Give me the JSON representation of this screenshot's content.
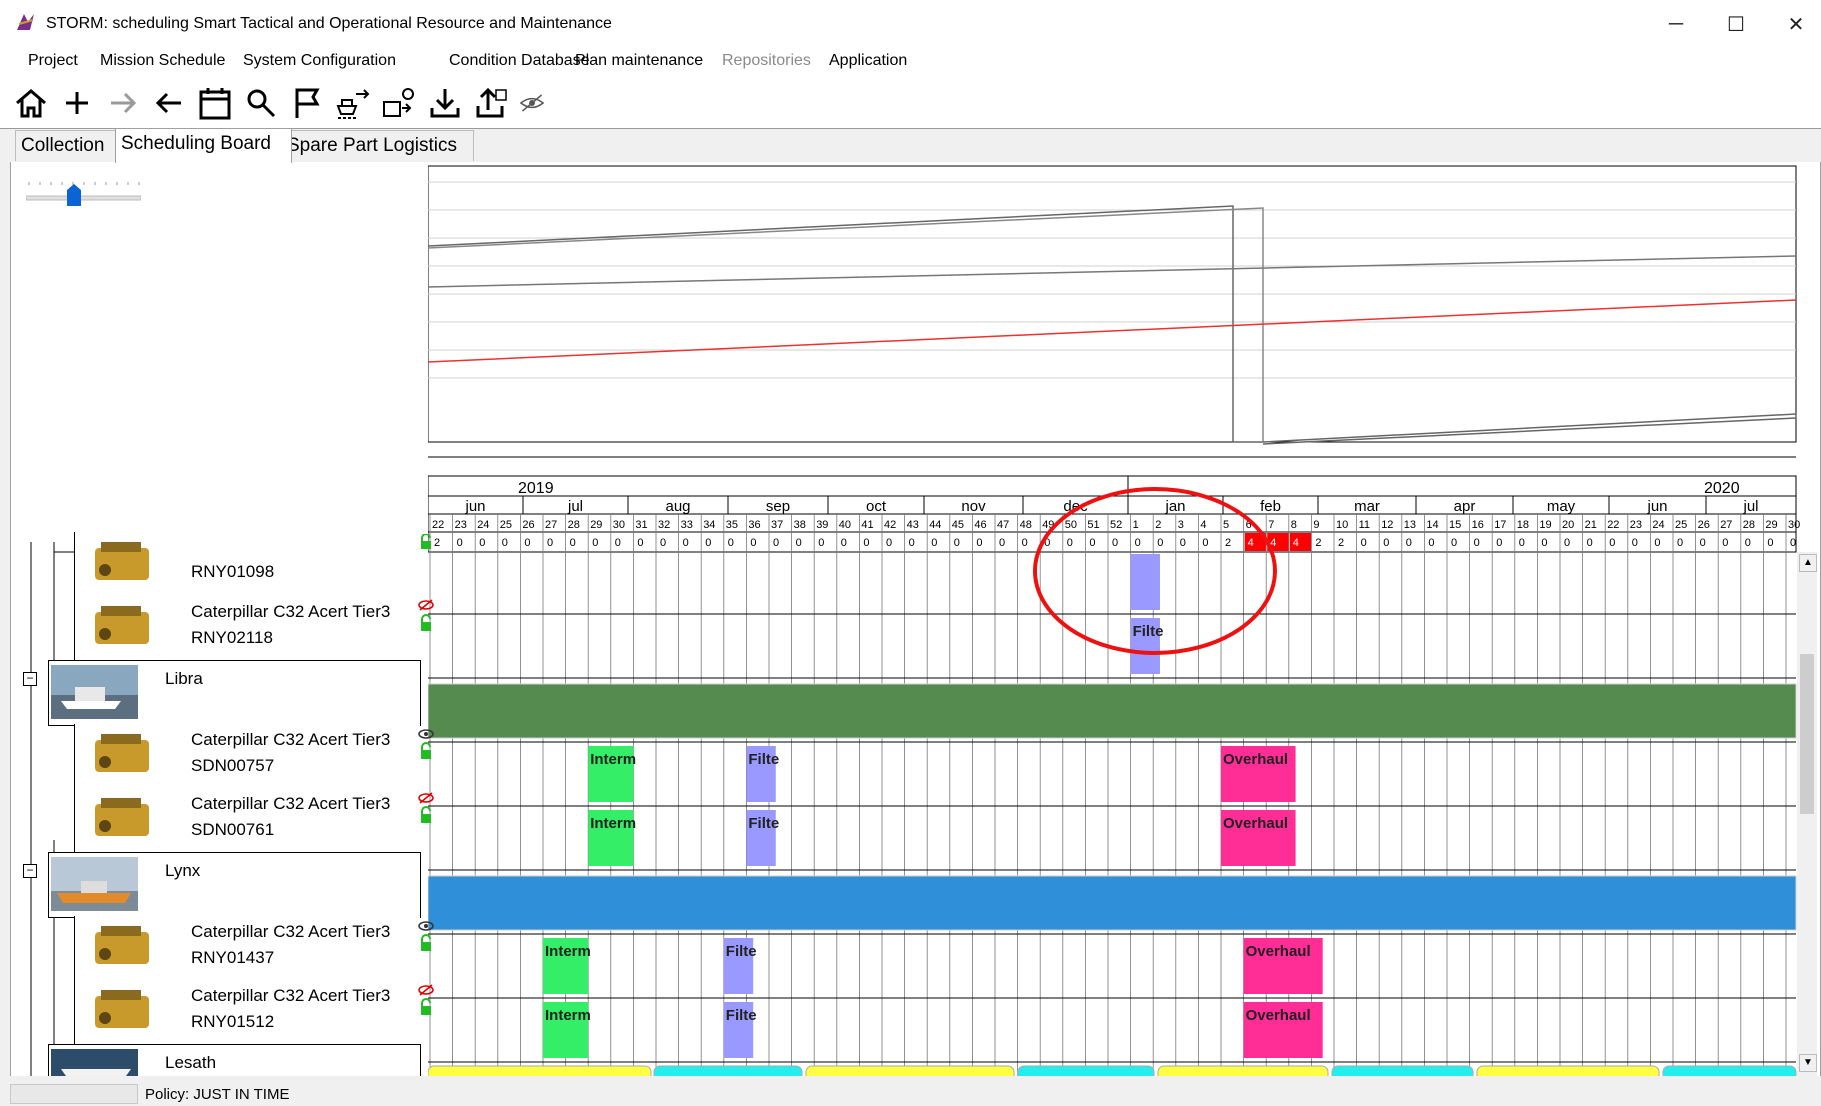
{
  "window": {
    "title": "STORM: scheduling Smart Tactical and Operational Resource and Maintenance",
    "minimize": "─",
    "maximize": "☐",
    "close": "✕"
  },
  "menu": [
    "Project",
    "Mission Schedule",
    "System Configuration",
    "Condition Database",
    "Plan maintenance",
    "Repositories",
    "Application"
  ],
  "toolbar": [
    "home-icon",
    "add-icon",
    "forward-arrow-icon",
    "back-arrow-icon",
    "calendar-icon",
    "search-icon",
    "flag-icon",
    "ship-transfer-icon",
    "engine-transfer-icon",
    "download-icon",
    "upload-icon",
    "visibility-icon"
  ],
  "tabs": [
    "Collection",
    "Scheduling Board",
    "Spare Part Logistics"
  ],
  "active_tab": "Scheduling Board",
  "timeline": {
    "years": [
      "2019",
      "2020"
    ],
    "months": [
      "jun",
      "jul",
      "aug",
      "sep",
      "oct",
      "nov",
      "dec",
      "jan",
      "feb",
      "mar",
      "apr",
      "may",
      "jun",
      "jul"
    ],
    "weeks": [
      "22",
      "23",
      "24",
      "25",
      "26",
      "27",
      "28",
      "29",
      "30",
      "31",
      "32",
      "33",
      "34",
      "35",
      "36",
      "37",
      "38",
      "39",
      "40",
      "41",
      "42",
      "43",
      "44",
      "45",
      "46",
      "47",
      "48",
      "49",
      "50",
      "51",
      "52",
      "1",
      "2",
      "3",
      "4",
      "5",
      "6",
      "7",
      "8",
      "9",
      "10",
      "11",
      "12",
      "13",
      "14",
      "15",
      "16",
      "17",
      "18",
      "19",
      "20",
      "21",
      "22",
      "23",
      "24",
      "25",
      "26",
      "27",
      "28",
      "29",
      "30"
    ],
    "counts": [
      "2",
      "0",
      "0",
      "0",
      "0",
      "0",
      "0",
      "0",
      "0",
      "0",
      "0",
      "0",
      "0",
      "0",
      "0",
      "0",
      "0",
      "0",
      "0",
      "0",
      "0",
      "0",
      "0",
      "0",
      "0",
      "0",
      "0",
      "0",
      "0",
      "0",
      "0",
      "0",
      "0",
      "0",
      "0",
      "2",
      "4",
      "4",
      "4",
      "2",
      "2",
      "0",
      "0",
      "0",
      "0",
      "0",
      "0",
      "0",
      "0",
      "0",
      "0",
      "0",
      "0",
      "0",
      "0",
      "0",
      "0",
      "0",
      "0",
      "0",
      "0"
    ],
    "highlight_color": "#ff0000",
    "annotation": "red-circle-highlight"
  },
  "rows": [
    {
      "kind": "resource",
      "line1": "",
      "line2": "RNY01098"
    },
    {
      "kind": "resource",
      "line1": "Caterpillar C32 Acert Tier3",
      "line2": "RNY02118"
    },
    {
      "kind": "ship",
      "name": "Libra",
      "color": "#558b4f"
    },
    {
      "kind": "resource",
      "line1": "Caterpillar C32 Acert Tier3",
      "line2": "SDN00757"
    },
    {
      "kind": "resource",
      "line1": "Caterpillar C32 Acert Tier3",
      "line2": "SDN00761"
    },
    {
      "kind": "ship",
      "name": "Lynx",
      "color": "#2f8fd8"
    },
    {
      "kind": "resource",
      "line1": "Caterpillar C32 Acert Tier3",
      "line2": "RNY01437"
    },
    {
      "kind": "resource",
      "line1": "Caterpillar C32 Acert Tier3",
      "line2": "RNY01512"
    },
    {
      "kind": "ship",
      "name": "Lesath",
      "color": "#ffff44"
    }
  ],
  "tasks": [
    {
      "row": 0,
      "label": "",
      "color": "#9999ff"
    },
    {
      "row": 1,
      "label": "Filte",
      "color": "#9999ff"
    },
    {
      "row": 3,
      "label": "Interm",
      "color": "#33ee66"
    },
    {
      "row": 3,
      "label": "Filte",
      "color": "#9999ff"
    },
    {
      "row": 3,
      "label": "Overhaul",
      "color": "#ff2d95"
    },
    {
      "row": 4,
      "label": "Interm",
      "color": "#33ee66"
    },
    {
      "row": 4,
      "label": "Filte",
      "color": "#9999ff"
    },
    {
      "row": 4,
      "label": "Overhaul",
      "color": "#ff2d95"
    },
    {
      "row": 6,
      "label": "Interm",
      "color": "#33ee66"
    },
    {
      "row": 6,
      "label": "Filte",
      "color": "#9999ff"
    },
    {
      "row": 6,
      "label": "Overhaul",
      "color": "#ff2d95"
    },
    {
      "row": 7,
      "label": "Interm",
      "color": "#33ee66"
    },
    {
      "row": 7,
      "label": "Filte",
      "color": "#9999ff"
    },
    {
      "row": 7,
      "label": "Overhaul",
      "color": "#ff2d95"
    }
  ],
  "status": {
    "policy": "Policy: JUST IN TIME"
  }
}
